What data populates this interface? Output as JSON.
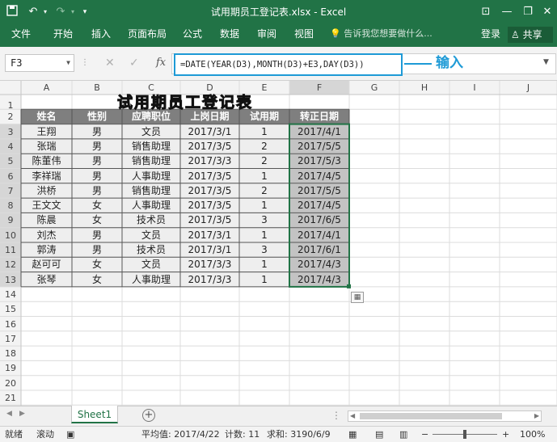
{
  "titlebar": {
    "title": "试用期员工登记表.xlsx - Excel",
    "save_icon": "save-icon",
    "undo_icon": "undo-icon",
    "redo_icon": "redo-icon",
    "qat_icon": "customize-qat-icon"
  },
  "ribbon": {
    "tabs": [
      "文件",
      "开始",
      "插入",
      "页面布局",
      "公式",
      "数据",
      "审阅",
      "视图"
    ],
    "tell_me": "告诉我您想要做什么...",
    "login": "登录",
    "share": "共享"
  },
  "formula_bar": {
    "name_box": "F3",
    "formula": "=DATE(YEAR(D3),MONTH(D3)+E3,DAY(D3))",
    "annotation": "输入"
  },
  "grid": {
    "columns": [
      "A",
      "B",
      "C",
      "D",
      "E",
      "F",
      "G",
      "H",
      "I",
      "J"
    ],
    "rows": [
      "1",
      "2",
      "3",
      "4",
      "5",
      "6",
      "7",
      "8",
      "9",
      "10",
      "11",
      "12",
      "13",
      "14",
      "15",
      "16",
      "17",
      "18",
      "19",
      "20",
      "21",
      "22"
    ],
    "table_title": "试用期员工登记表",
    "headers": [
      "姓名",
      "性别",
      "应聘职位",
      "上岗日期",
      "试用期",
      "转正日期"
    ],
    "data": [
      [
        "王翔",
        "男",
        "文员",
        "2017/3/1",
        "1",
        "2017/4/1"
      ],
      [
        "张瑞",
        "男",
        "销售助理",
        "2017/3/5",
        "2",
        "2017/5/5"
      ],
      [
        "陈董伟",
        "男",
        "销售助理",
        "2017/3/3",
        "2",
        "2017/5/3"
      ],
      [
        "李祥瑞",
        "男",
        "人事助理",
        "2017/3/5",
        "1",
        "2017/4/5"
      ],
      [
        "洪桥",
        "男",
        "销售助理",
        "2017/3/5",
        "2",
        "2017/5/5"
      ],
      [
        "王文文",
        "女",
        "人事助理",
        "2017/3/5",
        "1",
        "2017/4/5"
      ],
      [
        "陈晨",
        "女",
        "技术员",
        "2017/3/5",
        "3",
        "2017/6/5"
      ],
      [
        "刘杰",
        "男",
        "文员",
        "2017/3/1",
        "1",
        "2017/4/1"
      ],
      [
        "郭涛",
        "男",
        "技术员",
        "2017/3/1",
        "3",
        "2017/6/1"
      ],
      [
        "赵可可",
        "女",
        "文员",
        "2017/3/3",
        "1",
        "2017/4/3"
      ],
      [
        "张琴",
        "女",
        "人事助理",
        "2017/3/3",
        "1",
        "2017/4/3"
      ]
    ]
  },
  "sheets": {
    "tabs": [
      "Sheet1"
    ]
  },
  "status": {
    "ready": "就绪",
    "scroll": "滚动",
    "average": "平均值: 2017/4/22",
    "count": "计数: 11",
    "sum": "求和: 3190/6/9",
    "zoom": "100%"
  },
  "colors": {
    "excel_green": "#217346",
    "header_fill": "#7f7f7f",
    "data_fill": "#eeeeee",
    "selection_fill": "#c3c3c3",
    "callout": "#1e9ad6"
  }
}
